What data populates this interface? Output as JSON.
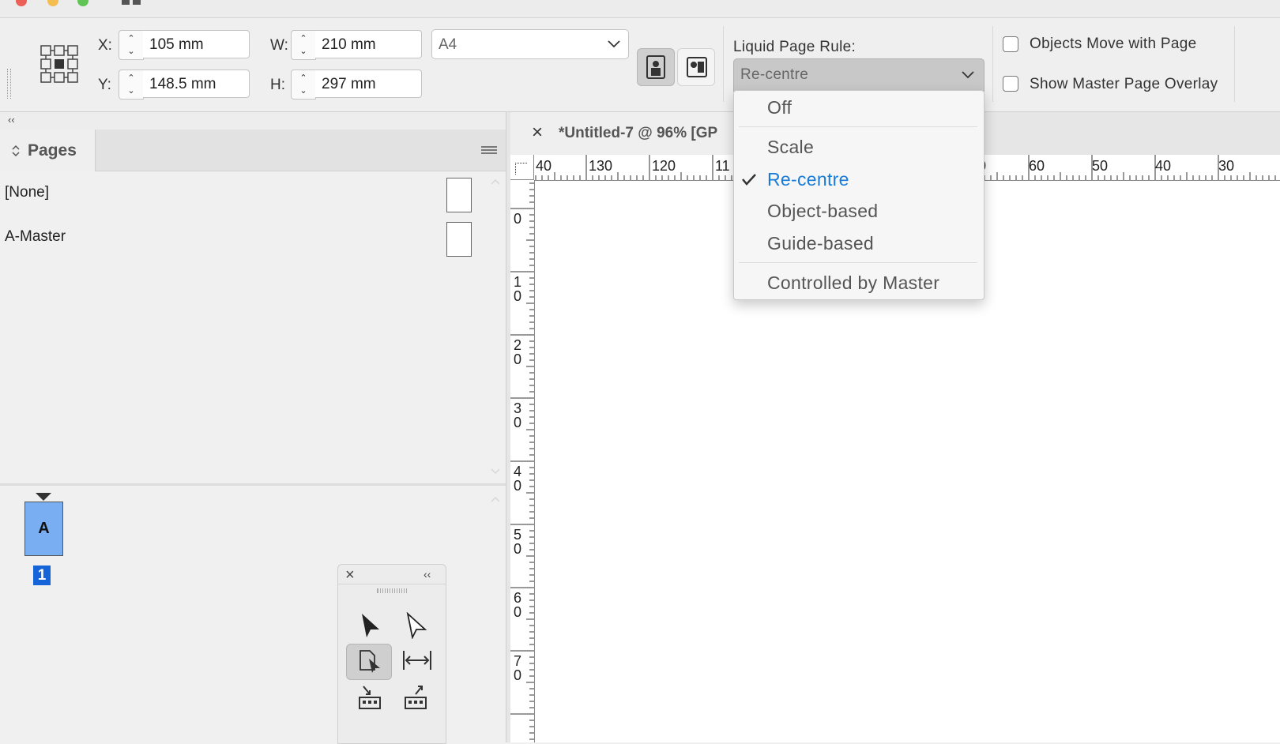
{
  "control_bar": {
    "x_label": "X:",
    "x_value": "105 mm",
    "y_label": "Y:",
    "y_value": "148.5 mm",
    "w_label": "W:",
    "w_value": "210 mm",
    "h_label": "H:",
    "h_value": "297 mm",
    "page_size": "A4",
    "liquid_rule_label": "Liquid Page Rule:",
    "liquid_rule_value": "Re-centre",
    "objects_move_label": "Objects Move with Page",
    "objects_move_checked": false,
    "show_overlay_label": "Show Master Page Overlay",
    "show_overlay_checked": false,
    "orientation": "portrait"
  },
  "liquid_menu": {
    "items": [
      "Off",
      "Scale",
      "Re-centre",
      "Object-based",
      "Guide-based",
      "Controlled by Master"
    ],
    "selected": "Re-centre",
    "selected_color": "#1a7bd6"
  },
  "panel": {
    "collapse_glyph": "‹‹",
    "tab_title": "Pages",
    "masters": [
      "[None]",
      "A-Master"
    ],
    "page_thumb_letter": "A",
    "page_number": "1",
    "thumb_color": "#7aaef2",
    "page_number_color": "#1565d8"
  },
  "document": {
    "tab_title": "*Untitled-7 @ 96% [GP",
    "close_glyph": "×"
  },
  "ruler": {
    "horizontal_left": [
      "40",
      "130",
      "120",
      "11"
    ],
    "horizontal_right": [
      "0",
      "60",
      "50",
      "40",
      "30"
    ],
    "vertical": [
      [
        "0"
      ],
      [
        "1",
        "0"
      ],
      [
        "2",
        "0"
      ],
      [
        "3",
        "0"
      ],
      [
        "4",
        "0"
      ],
      [
        "5",
        "0"
      ],
      [
        "6",
        "0"
      ],
      [
        "7",
        "0"
      ]
    ]
  },
  "tools": {
    "close_glyph": "×",
    "collapse_glyph": "‹‹"
  }
}
